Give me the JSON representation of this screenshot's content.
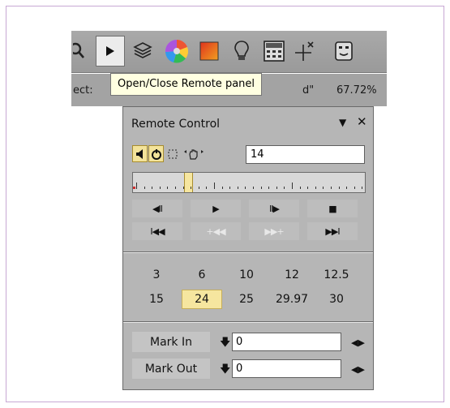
{
  "tooltip": "Open/Close Remote panel",
  "status": {
    "left": "ect:",
    "mid": "d\"",
    "right": "67.72%"
  },
  "toolbar": {
    "icons": [
      "magnifier-icon",
      "play-icon",
      "layers-icon",
      "color-wheel-icon",
      "gradient-swatch-icon",
      "lightbulb-icon",
      "calculator-icon",
      "crosshair-icon",
      "mask-icon"
    ]
  },
  "remote": {
    "title": "Remote Control",
    "menu_glyph": "▼",
    "close_glyph": "✕",
    "frame_value": "14",
    "transport": {
      "row1": [
        "◀II",
        "▶",
        "II▶",
        "■"
      ],
      "row2": [
        "I◀◀",
        "+◀◀",
        "▶▶+",
        "▶▶I"
      ]
    },
    "fps_row1": [
      "3",
      "6",
      "10",
      "12",
      "12.5"
    ],
    "fps_row2": [
      "15",
      "24",
      "25",
      "29.97",
      "30"
    ],
    "fps_selected": "24",
    "mark_in_label": "Mark In",
    "mark_out_label": "Mark Out",
    "mark_in_value": "0",
    "mark_out_value": "0",
    "mark_arrow": "🡇",
    "mark_nav": "◀▶"
  },
  "colors": {
    "accent": "#f6e69f",
    "panel": "#b6b6b6",
    "tooltip_bg": "#ffffe1"
  }
}
